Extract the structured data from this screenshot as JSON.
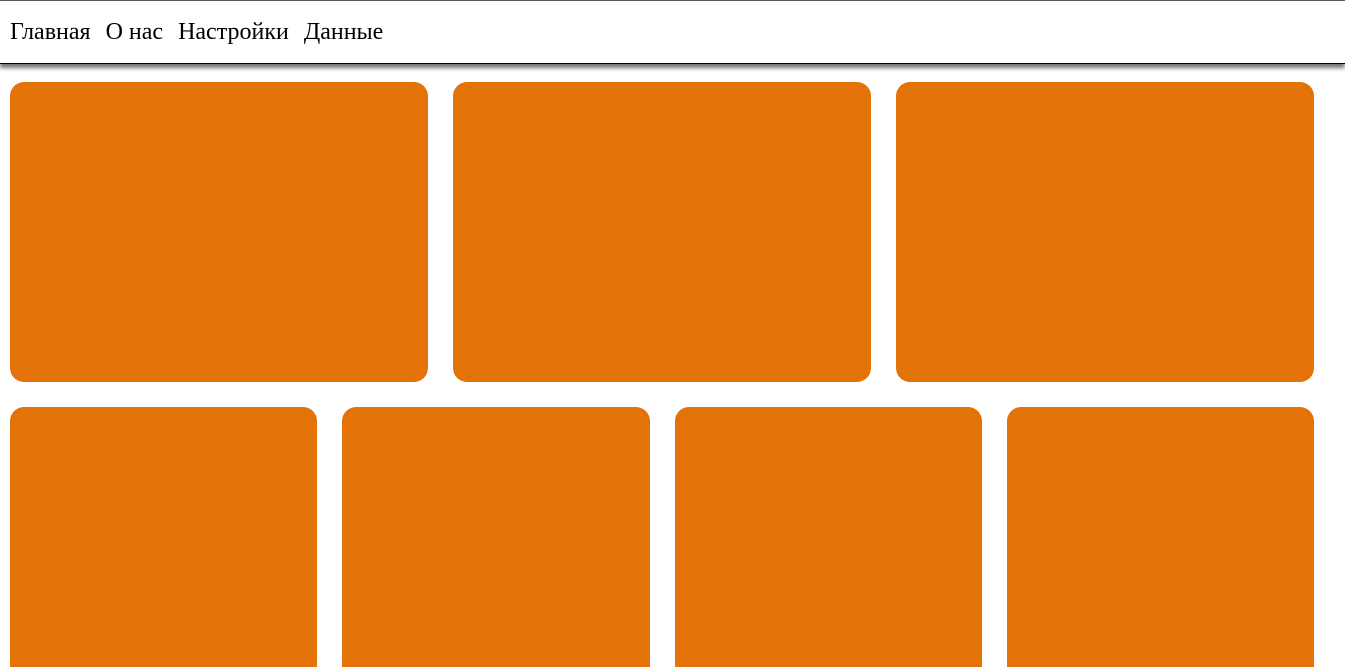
{
  "nav": {
    "items": [
      {
        "label": "Главная"
      },
      {
        "label": "О нас"
      },
      {
        "label": "Настройки"
      },
      {
        "label": "Данные"
      }
    ]
  },
  "colors": {
    "card": "#e37208",
    "background": "#ffffff",
    "text": "#000000"
  },
  "cards": {
    "top_row_count": 3,
    "bottom_row_count": 4
  }
}
